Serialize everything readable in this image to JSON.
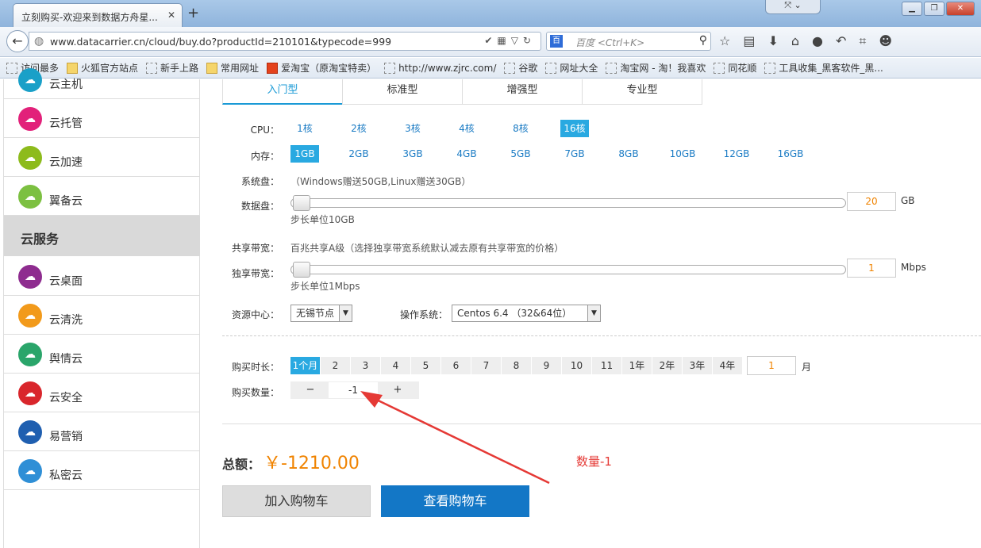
{
  "browser": {
    "tab_title": "立刻购买-欢迎来到数据方舟星...",
    "tab_close": "✕",
    "new_tab": "+",
    "url": "www.datacarrier.cn/cloud/buy.do?productId=210101&typecode=999",
    "search_placeholder": "百度 <Ctrl+K>",
    "bookmarks": [
      {
        "label": "访问最多",
        "icon": "gear-icon"
      },
      {
        "label": "火狐官方站点",
        "icon": "folder-icon"
      },
      {
        "label": "新手上路",
        "icon": "page-icon"
      },
      {
        "label": "常用网址",
        "icon": "folder-icon"
      },
      {
        "label": "爱淘宝（原淘宝特卖）",
        "icon": "taobao-icon"
      },
      {
        "label": "http://www.zjrc.com/",
        "icon": "page-icon"
      },
      {
        "label": "谷歌",
        "icon": "page-icon"
      },
      {
        "label": "网址大全",
        "icon": "page-icon"
      },
      {
        "label": "淘宝网 - 淘！我喜欢",
        "icon": "page-icon"
      },
      {
        "label": "同花顺",
        "icon": "page-icon"
      },
      {
        "label": "工具收集_黑客软件_黑...",
        "icon": "page-icon"
      }
    ]
  },
  "sidebar": {
    "items_top": [
      {
        "label": "云主机",
        "color": "#1aa0c8"
      },
      {
        "label": "云托管",
        "color": "#e2217a"
      },
      {
        "label": "云加速",
        "color": "#8dbb1c"
      },
      {
        "label": "翼备云",
        "color": "#7cc041"
      }
    ],
    "section_title": "云服务",
    "items_bottom": [
      {
        "label": "云桌面",
        "color": "#8e2c8f"
      },
      {
        "label": "云清洗",
        "color": "#f29a1b"
      },
      {
        "label": "舆情云",
        "color": "#2aa56a"
      },
      {
        "label": "云安全",
        "color": "#d9262c"
      },
      {
        "label": "易营销",
        "color": "#1f5fb0"
      },
      {
        "label": "私密云",
        "color": "#2f8fd6"
      }
    ]
  },
  "config": {
    "types": [
      "入门型",
      "标准型",
      "增强型",
      "专业型"
    ],
    "cpu_label": "CPU：",
    "cpu_options": [
      "1核",
      "2核",
      "3核",
      "4核",
      "8核",
      "16核"
    ],
    "cpu_selected": 5,
    "mem_label": "内存：",
    "mem_options": [
      "1GB",
      "2GB",
      "3GB",
      "4GB",
      "5GB",
      "7GB",
      "8GB",
      "10GB",
      "12GB",
      "16GB"
    ],
    "mem_selected": 0,
    "sysdisk_label": "系统盘：",
    "sysdisk_note": "（Windows赠送50GB,Linux赠送30GB）",
    "datadisk_label": "数据盘：",
    "datadisk_value": "20",
    "datadisk_unit": "GB",
    "datadisk_step": "步长单位10GB",
    "shared_bw_label": "共享带宽：",
    "shared_bw_note": "百兆共享A级（选择独享带宽系统默认减去原有共享带宽的价格）",
    "dedicated_bw_label": "独享带宽：",
    "dedicated_bw_value": "1",
    "dedicated_bw_unit": "Mbps",
    "dedicated_bw_step": "步长单位1Mbps",
    "dc_label": "资源中心：",
    "dc_value": "无锡节点",
    "os_label": "操作系统：",
    "os_value": "Centos 6.4 （32&64位）",
    "duration_label": "购买时长：",
    "duration_options": [
      "1个月",
      "2",
      "3",
      "4",
      "5",
      "6",
      "7",
      "8",
      "9",
      "10",
      "11",
      "1年",
      "2年",
      "3年",
      "4年"
    ],
    "duration_selected": 0,
    "duration_value": "1",
    "duration_unit": "月",
    "qty_label": "购买数量：",
    "qty_minus": "−",
    "qty_plus": "+",
    "qty_value": "-1"
  },
  "summary": {
    "total_label": "总额：",
    "total_value": "￥-1210.00",
    "add_cart": "加入购物车",
    "view_cart": "查看购物车"
  },
  "annotation": {
    "text": "数量-1",
    "color": "#e53935"
  }
}
